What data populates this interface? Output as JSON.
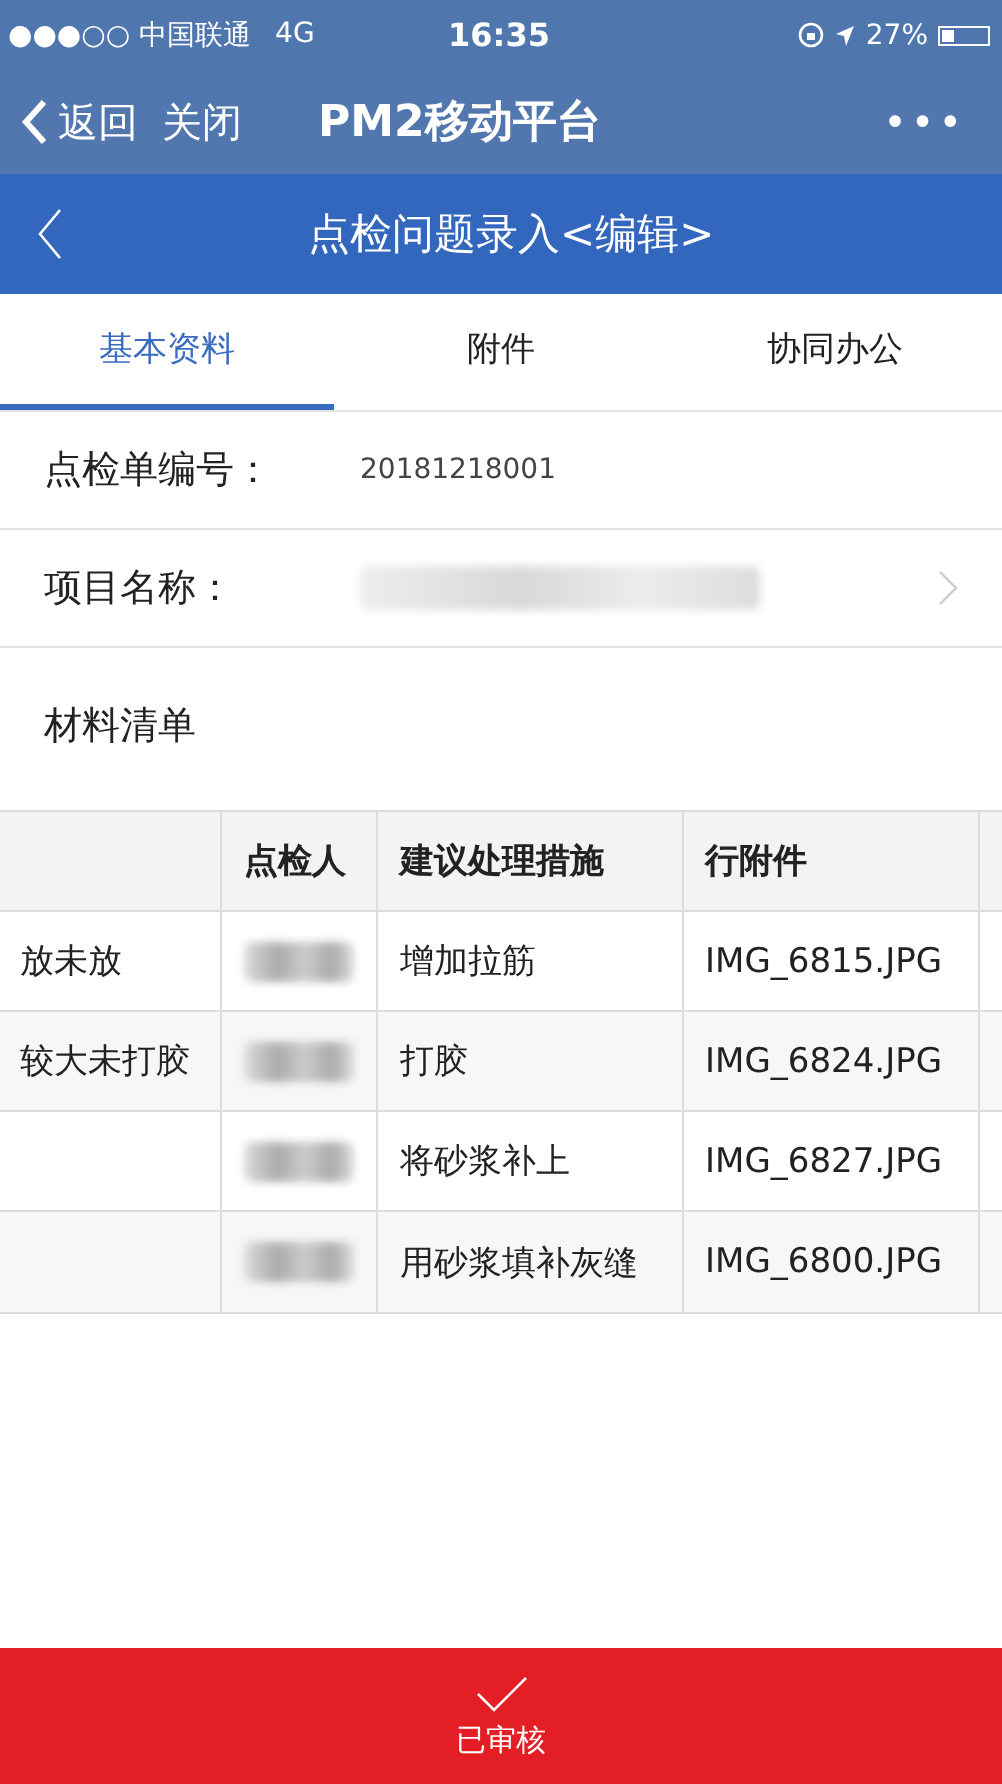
{
  "status_bar": {
    "carrier": "●●●○○ 中国联通",
    "network": "4G",
    "time": "16:35",
    "battery": "27%",
    "level": 0.27
  },
  "nav_bar": {
    "back": "返回",
    "close": "关闭",
    "title": "PM2移动平台",
    "more": "•••"
  },
  "header": {
    "title": "点检问题录入<编辑>"
  },
  "tabs": [
    {
      "label": "基本资料",
      "selected": true
    },
    {
      "label": "附件",
      "selected": false
    },
    {
      "label": "协同办公",
      "selected": false
    }
  ],
  "fields": [
    {
      "label": "点检单编号：",
      "value": "20181218001",
      "redacted": false,
      "has_arrow": false
    },
    {
      "label": "项目名称：",
      "redacted": true,
      "has_arrow": true
    }
  ],
  "section_title": "材料清单",
  "table": {
    "columns": [
      "",
      "点检人",
      "建议处理措施",
      "行附件"
    ],
    "rows": [
      {
        "column_1": "放未放",
        "inspector_redacted": true,
        "measure": "增加拉筋",
        "attachment": "IMG_6815.JPG"
      },
      {
        "column_1": "较大未打胶",
        "inspector_redacted": true,
        "measure": "打胶",
        "attachment": "IMG_6824.JPG"
      },
      {
        "column_1": "",
        "inspector_redacted": true,
        "measure": "将砂浆补上",
        "attachment": "IMG_6827.JPG"
      },
      {
        "column_1": "",
        "inspector_redacted": true,
        "measure": "用砂浆填补灰缝",
        "attachment": "IMG_6800.JPG"
      }
    ]
  },
  "bottom_button": {
    "label": "已审核"
  }
}
